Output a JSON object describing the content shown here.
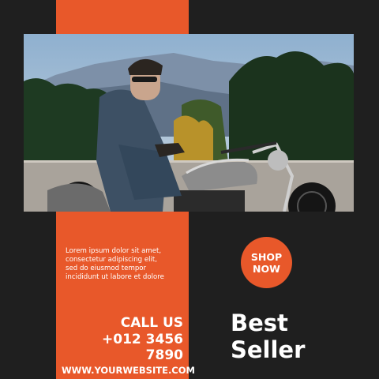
{
  "colors": {
    "background": "#1f1f1f",
    "accent": "#e8582a",
    "text": "#ffffff"
  },
  "photo": {
    "subject": "man in denim jacket seated on a vintage motorcycle"
  },
  "body_text": {
    "line1": "Lorem ipsum dolor sit amet,",
    "line2": "consectetur adipiscing elit,",
    "line3": "sed do eiusmod tempor",
    "line4": "incididunt ut labore et dolore"
  },
  "shop_button": {
    "line1": "SHOP",
    "line2": "NOW"
  },
  "contact": {
    "call_label": "CALL US",
    "phone": "+012 3456 7890",
    "website": "WWW.YOURWEBSITE.COM"
  },
  "headline": {
    "line1": "Best",
    "line2": "Seller"
  }
}
